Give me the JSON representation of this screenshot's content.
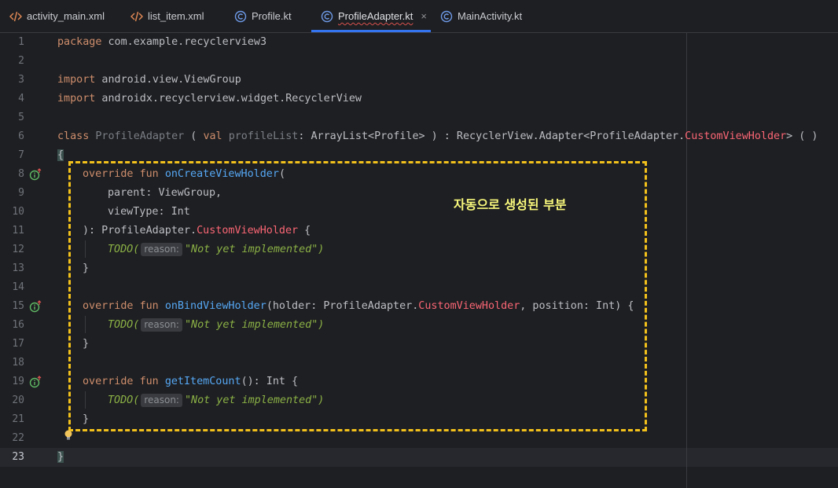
{
  "tabs": [
    {
      "label": "activity_main.xml",
      "icon": "xml-tag-icon"
    },
    {
      "label": "list_item.xml",
      "icon": "xml-tag-icon"
    },
    {
      "label": "Profile.kt",
      "icon": "kotlin-class-icon"
    },
    {
      "label": "ProfileAdapter.kt",
      "icon": "kotlin-class-icon",
      "close": "×"
    },
    {
      "label": "MainActivity.kt",
      "icon": "kotlin-class-icon"
    }
  ],
  "lines": [
    {
      "n": "1",
      "t": "package com.example.recyclerview3"
    },
    {
      "n": "2",
      "t": ""
    },
    {
      "n": "3",
      "t": "import android.view.ViewGroup"
    },
    {
      "n": "4",
      "t": "import androidx.recyclerview.widget.RecyclerView"
    },
    {
      "n": "5",
      "t": ""
    },
    {
      "n": "6",
      "t": "class ProfileAdapter ( val profileList: ArrayList<Profile> ) : RecyclerView.Adapter<ProfileAdapter.CustomViewHolder> ( )"
    },
    {
      "n": "7",
      "t": "{"
    },
    {
      "n": "8",
      "t": "    override fun onCreateViewHolder("
    },
    {
      "n": "9",
      "t": "        parent: ViewGroup,"
    },
    {
      "n": "10",
      "t": "        viewType: Int"
    },
    {
      "n": "11",
      "t": "    ): ProfileAdapter.CustomViewHolder {"
    },
    {
      "n": "12",
      "t": "        TODO( reason: \"Not yet implemented\")"
    },
    {
      "n": "13",
      "t": "    }"
    },
    {
      "n": "14",
      "t": ""
    },
    {
      "n": "15",
      "t": "    override fun onBindViewHolder(holder: ProfileAdapter.CustomViewHolder, position: Int) {"
    },
    {
      "n": "16",
      "t": "        TODO( reason: \"Not yet implemented\")"
    },
    {
      "n": "17",
      "t": "    }"
    },
    {
      "n": "18",
      "t": ""
    },
    {
      "n": "19",
      "t": "    override fun getItemCount(): Int {"
    },
    {
      "n": "20",
      "t": "        TODO( reason: \"Not yet implemented\")"
    },
    {
      "n": "21",
      "t": "    }"
    },
    {
      "n": "22",
      "t": ""
    },
    {
      "n": "23",
      "t": "}"
    }
  ],
  "tokens": {
    "package": "package",
    "import": "import",
    "class": "class",
    "val": "val",
    "override": "override",
    "fun": "fun",
    "pkg": " com.example.recyclerview3",
    "imp1": " android.view.ViewGroup",
    "imp2": " androidx.recyclerview.widget.RecyclerView",
    "className": "ProfileAdapter",
    "paramName": "profileList",
    "sig1": ": ArrayList<Profile> ) : RecyclerView.Adapter<ProfileAdapter.",
    "customVH": "CustomViewHolder",
    "sig2": "> ( )",
    "open": " ( ",
    "lbrace": "{",
    "rbrace": "}",
    "onCreate": "onCreateViewHolder",
    "onBind": "onBindViewHolder",
    "getItem": "getItemCount",
    "paren": "(",
    "parent": "parent: ViewGroup,",
    "viewType": "viewType: Int",
    "ret1": "): ProfileAdapter.",
    "ret1end": " {",
    "bindArgs": "(holder: ProfileAdapter.",
    "bindArgs2": ", position: Int) {",
    "countSig": "(): Int {",
    "todo": "TODO(",
    "reason": "reason:",
    "msg": "\"Not yet implemented\")"
  },
  "annotation": "자동으로 생성된 부분",
  "gutter_icons": [
    "implements-override-icon",
    "implements-override-icon",
    "implements-override-icon"
  ],
  "colors": {
    "accent": "#3574f0",
    "annotation_box": "#f3c11b",
    "annotation_text": "#f8f87c"
  }
}
